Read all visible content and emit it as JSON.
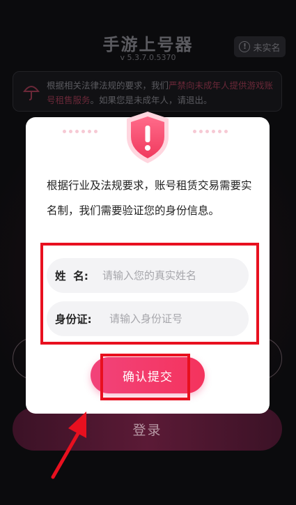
{
  "app": {
    "title": "手游上号器",
    "version": "v 5.3.7.0.5370",
    "unverified_label": "未实名"
  },
  "notice": {
    "text_prefix": "根据相关法律法规的要求，我们",
    "text_highlight": "严禁向未成年人提供游戏账号租售服务",
    "text_suffix": "。如果您是未成年人，请退出。"
  },
  "background": {
    "login_label": "登录"
  },
  "modal": {
    "message": "根据行业及法规要求，账号租赁交易需要实名制，我们需要验证您的身份信息。",
    "name_field": {
      "label": "姓  名:",
      "placeholder": "请输入您的真实姓名"
    },
    "id_field": {
      "label": "身份证:",
      "placeholder": "请输入身份证号"
    },
    "confirm_label": "确认提交"
  },
  "colors": {
    "accent": "#f2437a",
    "annotation": "#e8101f"
  }
}
